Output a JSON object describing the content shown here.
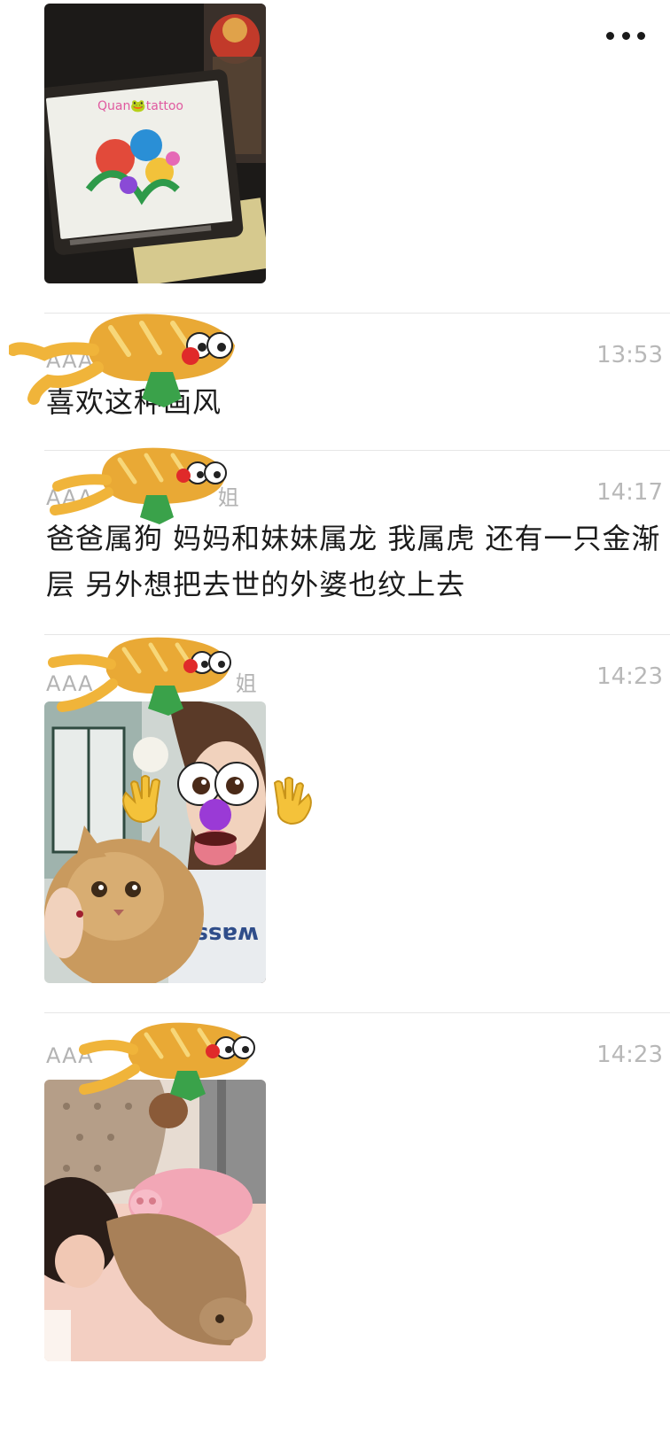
{
  "top_menu_icon": "more-dots-icon",
  "top_photo": {
    "watermark": "Quan🐸tattoo"
  },
  "comments": [
    {
      "sender": "AAA",
      "time": "13:53",
      "text": "喜欢这种画风"
    },
    {
      "sender": "AAA",
      "sender_suffix": "姐",
      "time": "14:17",
      "text": "爸爸属狗 妈妈和妹妹属龙 我属虎 还有一只金渐层 另外想把去世的外婆也纹上去"
    },
    {
      "sender": "AAA",
      "sender_suffix": "姐",
      "time": "14:23",
      "photo_shirt_text": "wassup"
    },
    {
      "sender": "AAA",
      "time": "14:23"
    }
  ],
  "sticker_icons": [
    "baguette-legs-sticker-icon",
    "waving-hand-icon",
    "googly-eyes-face-icon"
  ],
  "colors": {
    "divider": "#e6e6e6",
    "secondary_text": "#b3b3b3",
    "primary_text": "#1b1b1b"
  }
}
